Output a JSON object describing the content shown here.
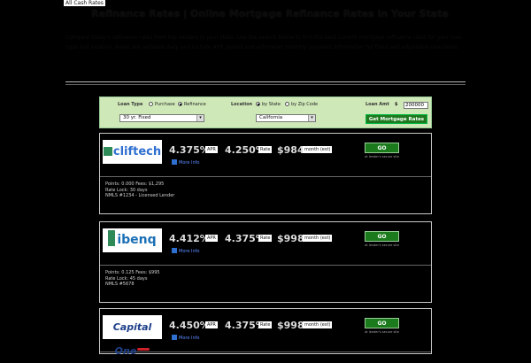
{
  "breadcrumb": "All Cash Rates",
  "title": "Refinance Rates | Online Mortgage Refinance Rates in Your State",
  "intro": "Compare today's refinance rates from top lenders in your state. Use the search below to find the best current mortgage refinance rates for your loan type and location. Rates are updated daily and include APR, points and estimated monthly payment information for fixed and adjustable rate loans.",
  "search": {
    "loan_type_label": "Loan Type",
    "purchase_label": "Purchase",
    "refinance_label": "Refinance",
    "loan_product": "30 yr. Fixed",
    "location_label": "Location",
    "by_state_label": "by State",
    "by_zip_label": "by Zip Code",
    "state": "California",
    "loan_amt_label": "Loan Amt",
    "currency": "$",
    "loan_amt_value": "200000",
    "submit_label": "Get Mortgage Rates"
  },
  "offers": [
    {
      "lender": "cliftech",
      "apr": "4.375%",
      "apr_tag": "APR",
      "rate": "4.250%",
      "rate_tag": "Rate",
      "payment": "$984",
      "payment_tag": "month (est)",
      "go_label": "GO",
      "go_sub": "at lender's secure site",
      "link_label": "More Info",
      "details": [
        "Points: 0.000  Fees: $1,295",
        "Rate Lock: 30 days",
        "NMLS #1234 - Licensed Lender"
      ]
    },
    {
      "lender": "ibenq",
      "apr": "4.412%",
      "apr_tag": "APR",
      "rate": "4.375%",
      "rate_tag": "Rate",
      "payment": "$998",
      "payment_tag": "month (est)",
      "go_label": "GO",
      "go_sub": "at lender's secure site",
      "link_label": "More Info",
      "details": [
        "Points: 0.125  Fees: $995",
        "Rate Lock: 45 days",
        "NMLS #5678"
      ]
    },
    {
      "lender": "Capital One",
      "apr": "4.450%",
      "apr_tag": "APR",
      "rate": "4.375%",
      "rate_tag": "Rate",
      "payment": "$998",
      "payment_tag": "month (est)",
      "go_label": "GO",
      "go_sub": "at lender's secure site",
      "link_label": "More Info",
      "details": []
    }
  ],
  "colors": {
    "bar_bg": "#cfe8b8",
    "go_bg": "#1b7a1b",
    "capital_one_blue": "#1e3f8a",
    "capital_one_red": "#cc2127"
  }
}
